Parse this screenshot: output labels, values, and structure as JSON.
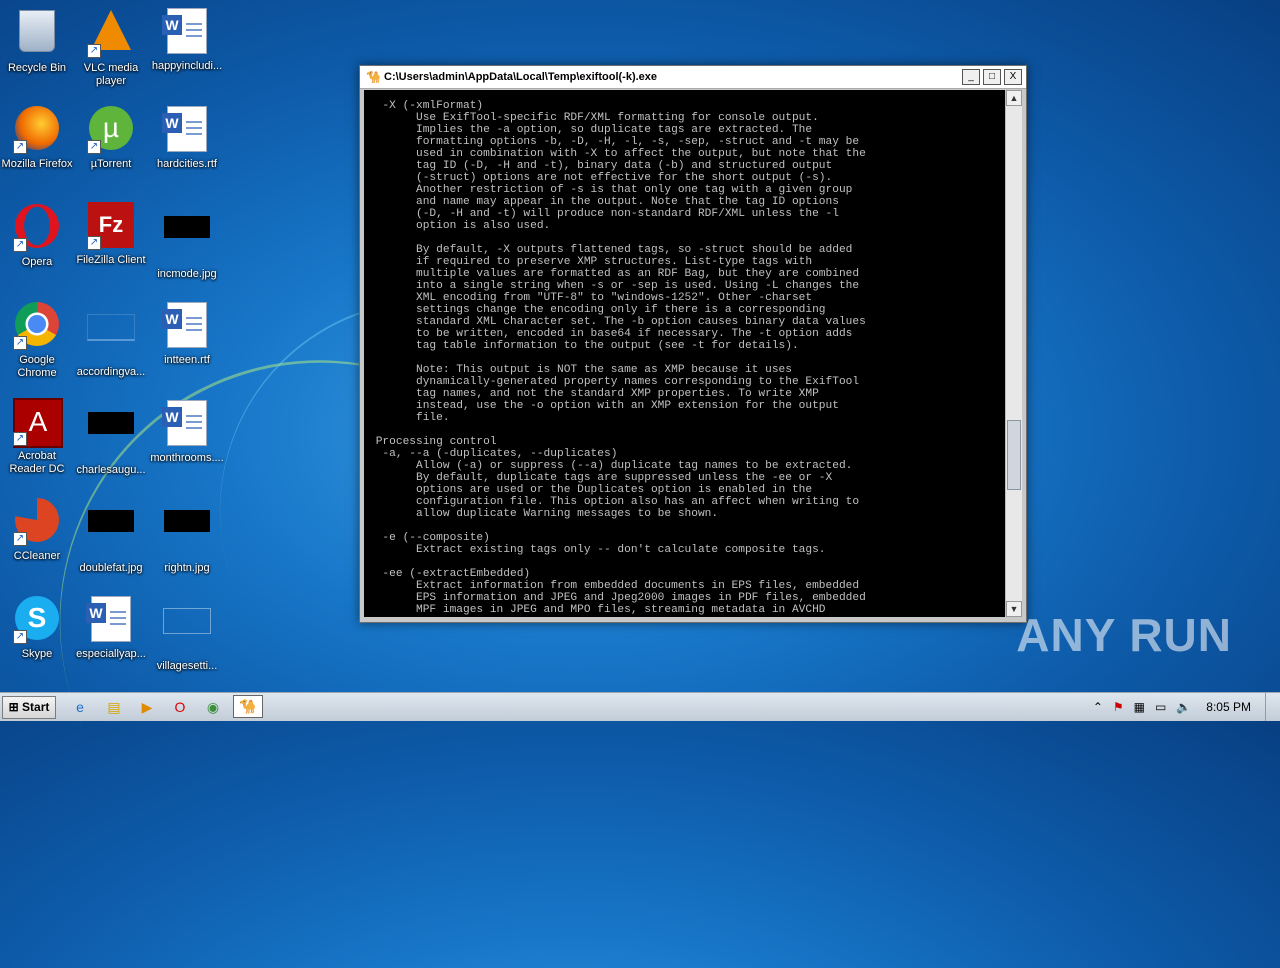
{
  "desktop": {
    "icons": [
      {
        "label": "Recycle Bin",
        "icon": "recycle-bin-icon"
      },
      {
        "label": "VLC media player",
        "icon": "vlc-icon"
      },
      {
        "label": "happyincludi...",
        "icon": "word-doc-icon"
      },
      {
        "label": "Mozilla Firefox",
        "icon": "firefox-icon"
      },
      {
        "label": "µTorrent",
        "icon": "utorrent-icon"
      },
      {
        "label": "hardcities.rtf",
        "icon": "word-doc-icon"
      },
      {
        "label": "Opera",
        "icon": "opera-icon"
      },
      {
        "label": "FileZilla Client",
        "icon": "filezilla-icon"
      },
      {
        "label": "incmode.jpg",
        "icon": "image-thumbnail-icon"
      },
      {
        "label": "Google Chrome",
        "icon": "chrome-icon"
      },
      {
        "label": "accordingva...",
        "icon": "file-icon"
      },
      {
        "label": "intteen.rtf",
        "icon": "word-doc-icon"
      },
      {
        "label": "Acrobat Reader DC",
        "icon": "acrobat-icon"
      },
      {
        "label": "charlesaugu...",
        "icon": "image-thumbnail-icon"
      },
      {
        "label": "monthrooms....",
        "icon": "word-doc-icon"
      },
      {
        "label": "CCleaner",
        "icon": "ccleaner-icon"
      },
      {
        "label": "doublefat.jpg",
        "icon": "image-thumbnail-icon"
      },
      {
        "label": "rightn.jpg",
        "icon": "image-thumbnail-icon"
      },
      {
        "label": "Skype",
        "icon": "skype-icon"
      },
      {
        "label": "especiallyap...",
        "icon": "word-doc-icon"
      },
      {
        "label": "villagesetti...",
        "icon": "file-icon"
      }
    ]
  },
  "console_window": {
    "title": "C:\\Users\\admin\\AppData\\Local\\Temp\\exiftool(-k).exe",
    "buttons": {
      "minimize": "_",
      "maximize": "□",
      "close": "X"
    },
    "text": "  -X (-xmlFormat)\n       Use ExifTool-specific RDF/XML formatting for console output.\n       Implies the -a option, so duplicate tags are extracted. The\n       formatting options -b, -D, -H, -l, -s, -sep, -struct and -t may be\n       used in combination with -X to affect the output, but note that the\n       tag ID (-D, -H and -t), binary data (-b) and structured output\n       (-struct) options are not effective for the short output (-s).\n       Another restriction of -s is that only one tag with a given group\n       and name may appear in the output. Note that the tag ID options\n       (-D, -H and -t) will produce non-standard RDF/XML unless the -l\n       option is also used.\n\n       By default, -X outputs flattened tags, so -struct should be added\n       if required to preserve XMP structures. List-type tags with\n       multiple values are formatted as an RDF Bag, but they are combined\n       into a single string when -s or -sep is used. Using -L changes the\n       XML encoding from \"UTF-8\" to \"windows-1252\". Other -charset\n       settings change the encoding only if there is a corresponding\n       standard XML character set. The -b option causes binary data values\n       to be written, encoded in base64 if necessary. The -t option adds\n       tag table information to the output (see -t for details).\n\n       Note: This output is NOT the same as XMP because it uses\n       dynamically-generated property names corresponding to the ExifTool\n       tag names, and not the standard XMP properties. To write XMP\n       instead, use the -o option with an XMP extension for the output\n       file.\n\n Processing control\n  -a, --a (-duplicates, --duplicates)\n       Allow (-a) or suppress (--a) duplicate tag names to be extracted.\n       By default, duplicate tags are suppressed unless the -ee or -X\n       options are used or the Duplicates option is enabled in the\n       configuration file. This option also has an affect when writing to\n       allow duplicate Warning messages to be shown.\n\n  -e (--composite)\n       Extract existing tags only -- don't calculate composite tags.\n\n  -ee (-extractEmbedded)\n       Extract information from embedded documents in EPS files, embedded\n       EPS information and JPEG and Jpeg2000 images in PDF files, embedded\n       MPF images in JPEG and MPO files, streaming metadata in AVCHD"
  },
  "watermark": "ANY RUN",
  "taskbar": {
    "start_label": "Start",
    "clock": "8:05 PM"
  }
}
